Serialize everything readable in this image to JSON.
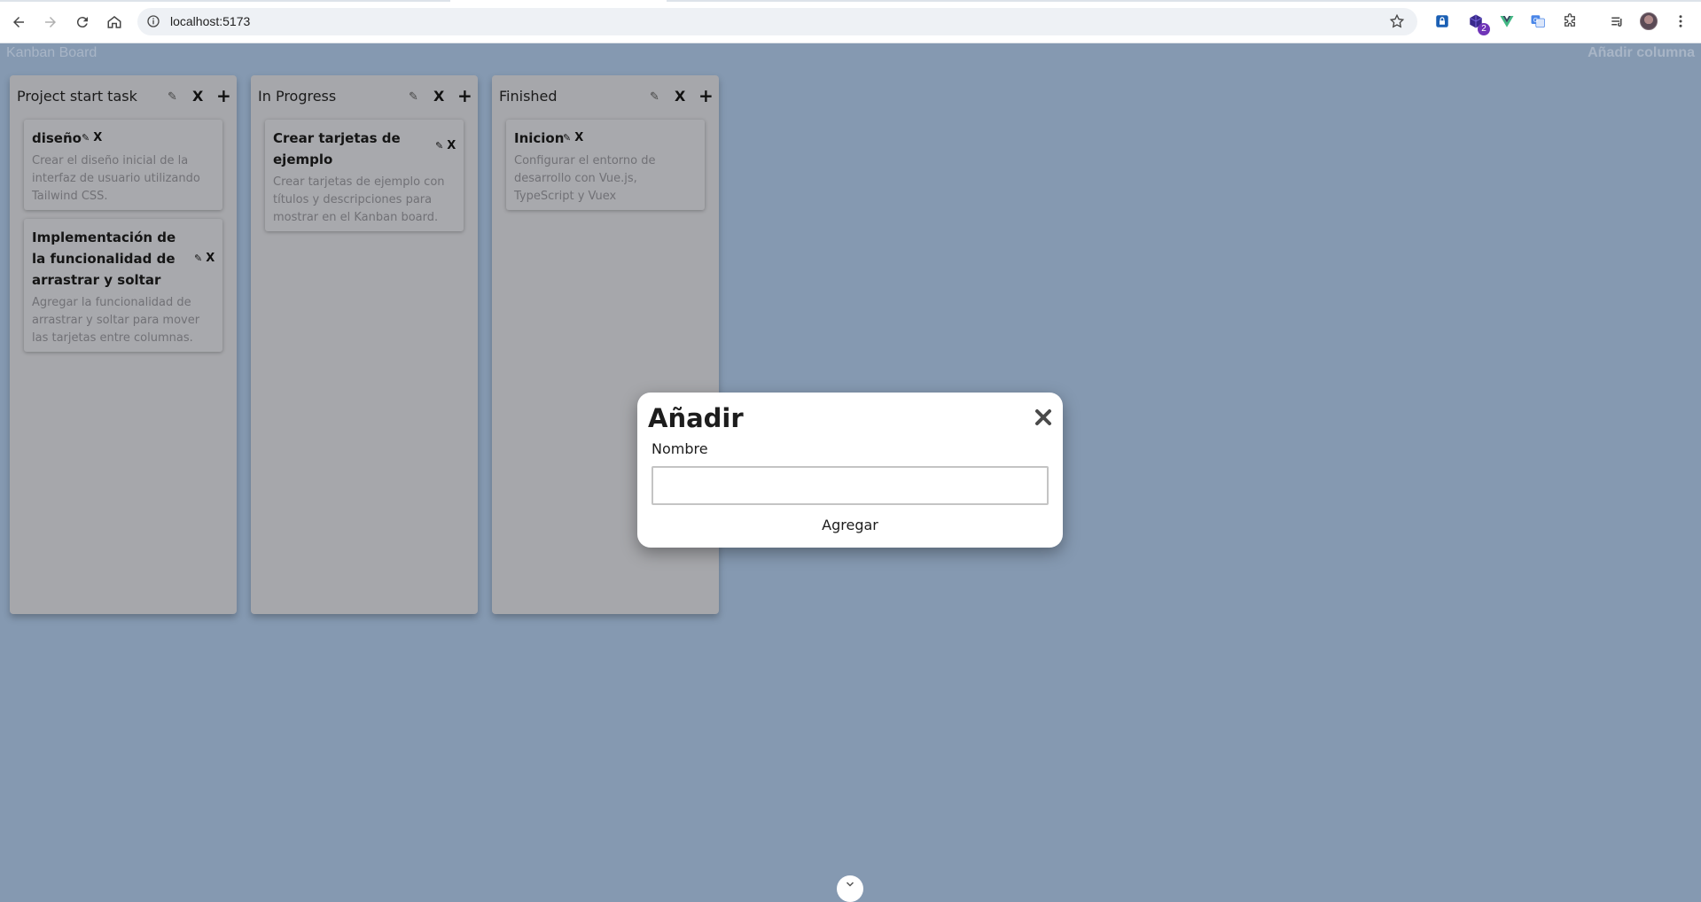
{
  "browser": {
    "url": "localhost:5173",
    "extension_badge": "2"
  },
  "app": {
    "title": "Kanban Board",
    "add_column_label": "Añadir columna"
  },
  "columns": [
    {
      "title": "Project start task",
      "edit_icon": "✎",
      "delete_label": "X",
      "add_label": "+",
      "cards": [
        {
          "title": "diseño",
          "edit_icon": "✎",
          "delete_label": "X",
          "description": "Crear el diseño inicial de la interfaz de usuario utilizando Tailwind CSS."
        },
        {
          "title": "Implementación de la funcionalidad de arrastrar y soltar",
          "edit_icon": "✎",
          "delete_label": "X",
          "description": "Agregar la funcionalidad de arrastrar y soltar para mover las tarjetas entre columnas."
        }
      ]
    },
    {
      "title": "In Progress",
      "edit_icon": "✎",
      "delete_label": "X",
      "add_label": "+",
      "cards": [
        {
          "title": "Crear tarjetas de ejemplo",
          "edit_icon": "✎",
          "delete_label": "X",
          "description": "Crear tarjetas de ejemplo con títulos y descripciones para mostrar en el Kanban board."
        }
      ]
    },
    {
      "title": "Finished",
      "edit_icon": "✎",
      "delete_label": "X",
      "add_label": "+",
      "cards": [
        {
          "title": "Inicion",
          "edit_icon": "✎",
          "delete_label": "X",
          "description": "Configurar el entorno de desarrollo con Vue.js, TypeScript y Vuex"
        }
      ]
    }
  ],
  "modal": {
    "title": "Añadir",
    "field_label": "Nombre",
    "field_value": "",
    "submit_label": "Agregar"
  }
}
